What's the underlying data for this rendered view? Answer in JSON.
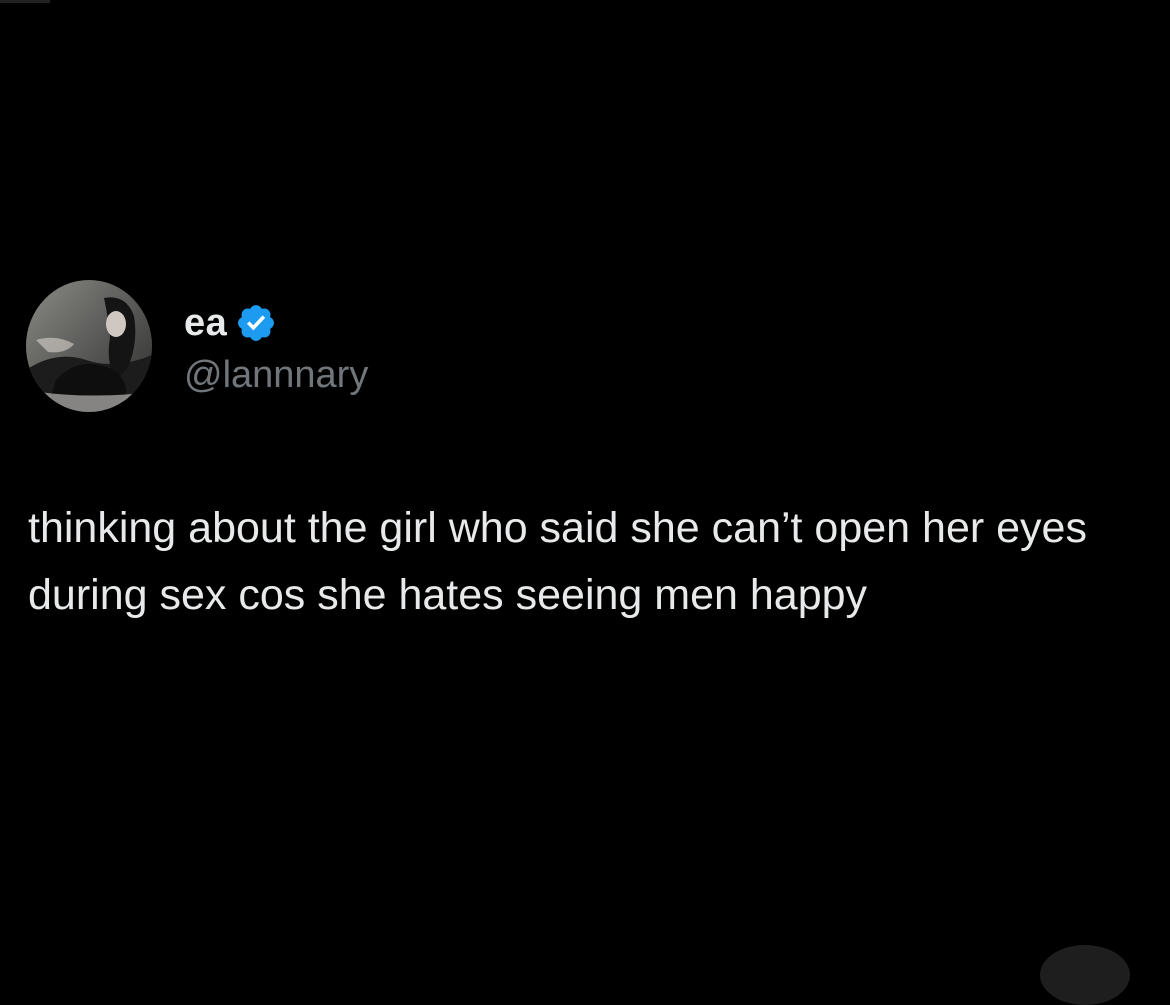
{
  "tweet": {
    "author": {
      "display_name": "ea",
      "handle": "@lannnary",
      "verified": true,
      "verified_color": "#1d9bf0",
      "avatar_icon": "profile-photo"
    },
    "text": "thinking about the girl who said she can’t open her eyes during sex cos she hates seeing men happy"
  },
  "colors": {
    "background": "#000000",
    "primary_text": "#e7e9ea",
    "secondary_text": "#71767b"
  }
}
